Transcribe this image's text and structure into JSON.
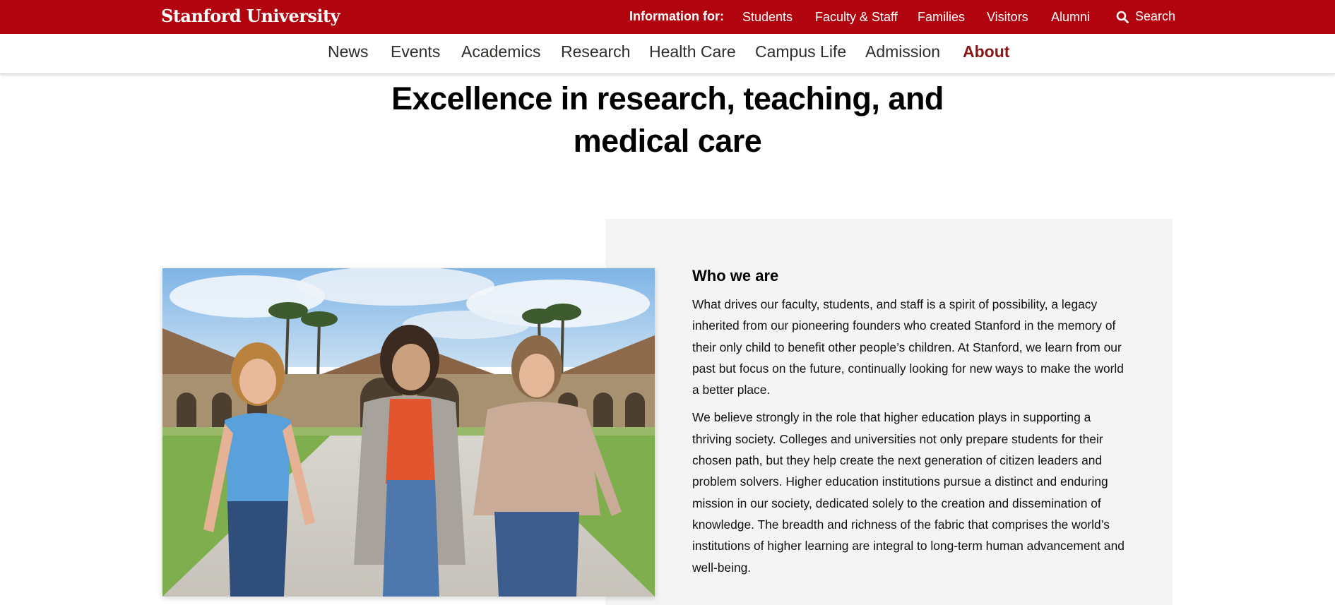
{
  "header": {
    "brand": "Stanford University",
    "info_label": "Information for:",
    "audience_links": [
      "Students",
      "Faculty & Staff",
      "Families",
      "Visitors",
      "Alumni"
    ],
    "search_label": "Search",
    "brand_color": "#b1040e"
  },
  "nav": {
    "items": [
      "News",
      "Events",
      "Academics",
      "Research",
      "Health Care",
      "Campus Life",
      "Admission",
      "About"
    ],
    "active": "About",
    "active_color": "#8c1515"
  },
  "page": {
    "headline_line1": "Excellence in research, teaching, and",
    "headline_line2": "medical care"
  },
  "who_we_are": {
    "heading": "Who we are",
    "paragraph1": "What drives our faculty, students, and staff is a spirit of possibility, a legacy inherited from our pioneering founders who created Stanford in the memory of their only child to benefit other people’s children. At Stanford, we learn from our past but focus on the future, continually looking for new ways to make the world a better place.",
    "paragraph2": "We believe strongly in the role that higher education plays in supporting a thriving society. Colleges and universities not only prepare students for their chosen path, but they help create the next generation of citizen leaders and problem solvers. Higher education institutions pursue a distinct and enduring mission in our society, dedicated solely to the creation and dissemination of knowledge. The breadth and richness of the fabric that comprises the world’s institutions of higher learning are integral to long-term human advancement and well-being."
  }
}
